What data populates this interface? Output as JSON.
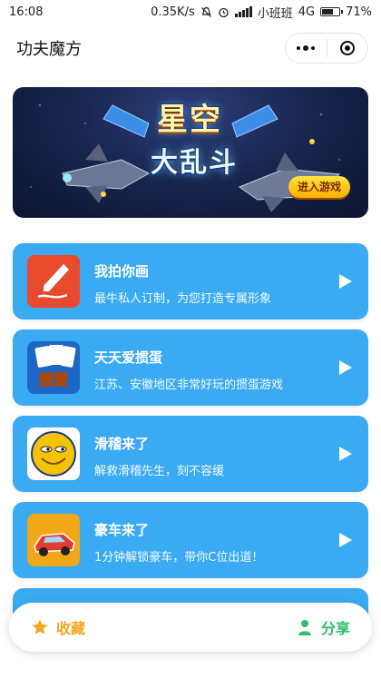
{
  "status": {
    "time": "16:08",
    "speed": "0.35K/s",
    "carrier": "小班班",
    "network": "4G",
    "battery": "71%",
    "battery_level": 0.71
  },
  "nav": {
    "title": "功夫魔方"
  },
  "banner": {
    "title": "星空",
    "subtitle": "大乱斗",
    "button": "进入游戏"
  },
  "cards": [
    {
      "title": "我拍你画",
      "desc": "最牛私人订制，为您打造专属形象",
      "icon": "brush-icon",
      "thumb_color": "#e84a2e"
    },
    {
      "title": "天天爱掼蛋",
      "desc": "江苏、安徽地区非常好玩的掼蛋游戏",
      "icon": "card-game-icon",
      "thumb_color": "#1e66c6"
    },
    {
      "title": "滑稽来了",
      "desc": "解救滑稽先生，刻不容缓",
      "icon": "smiley-face-icon",
      "thumb_color": "#f5c400"
    },
    {
      "title": "豪车来了",
      "desc": "1分钟解锁豪车，带你C位出道！",
      "icon": "race-car-icon",
      "thumb_color": "#f0a818"
    }
  ],
  "bottom": {
    "favorite": "收藏",
    "share": "分享"
  },
  "colors": {
    "card_bg": "#3aaaf2",
    "favorite": "#f5a623",
    "share": "#2dbf6b"
  }
}
